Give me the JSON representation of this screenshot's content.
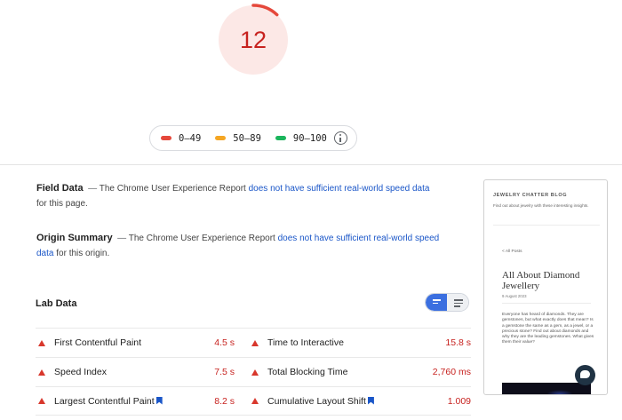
{
  "score": {
    "value": "12",
    "fraction": 0.12,
    "color": "#c7221f",
    "fill": "#fce8e6"
  },
  "legend": [
    {
      "label": "0–49",
      "color": "#e5483b"
    },
    {
      "label": "50–89",
      "color": "#f5a623"
    },
    {
      "label": "90–100",
      "color": "#1bb55c"
    }
  ],
  "field_data": {
    "title": "Field Data",
    "dash": "—",
    "text": "The Chrome User Experience Report",
    "link": "does not have sufficient real-world speed data",
    "suffix": "for this page."
  },
  "origin_summary": {
    "title": "Origin Summary",
    "dash": "—",
    "text": "The Chrome User Experience Report",
    "link": "does not have sufficient real-world speed data",
    "suffix": "for this origin."
  },
  "lab_data": {
    "title": "Lab Data"
  },
  "metrics": {
    "fcp": {
      "name": "First Contentful Paint",
      "value": "4.5 s"
    },
    "tti": {
      "name": "Time to Interactive",
      "value": "15.8 s"
    },
    "si": {
      "name": "Speed Index",
      "value": "7.5 s"
    },
    "tbt": {
      "name": "Total Blocking Time",
      "value": "2,760 ms"
    },
    "lcp": {
      "name": "Largest Contentful Paint",
      "value": "8.2 s"
    },
    "cls": {
      "name": "Cumulative Layout Shift",
      "value": "1.009"
    }
  },
  "thumbnail": {
    "blog_name": "JEWELRY CHATTER BLOG",
    "tagline": "Find out about jewelry with these interesting insights.",
    "back_link": "< All Posts",
    "post_title": "All About Diamond Jewellery",
    "date": "9 August 2023",
    "body": "Everyone has heard of diamonds. They are gemstones, but what exactly does that mean? Is a gemstone the same as a gem, as a jewel, or a precious stone? Find out about diamonds and why they are the leading gemstones. What gives them their value?"
  }
}
